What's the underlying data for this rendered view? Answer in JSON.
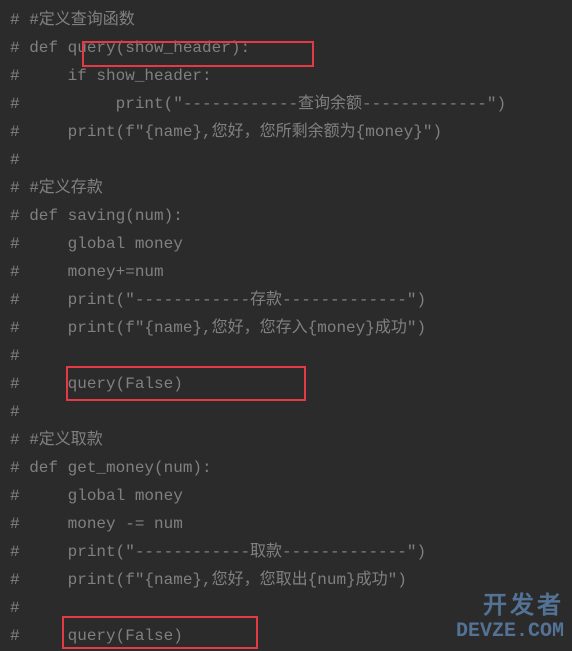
{
  "code": {
    "lines": [
      "# #定义查询函数",
      "# def query(show_header):",
      "#     if show_header:",
      "#          print(\"------------查询余额-------------\")",
      "#     print(f\"{name},您好，您所剩余额为{money}\")",
      "#",
      "# #定义存款",
      "# def saving(num):",
      "#     global money",
      "#     money+=num",
      "#     print(\"------------存款-------------\")",
      "#     print(f\"{name},您好，您存入{money}成功\")",
      "#",
      "#     query(False)",
      "#",
      "# #定义取款",
      "# def get_money(num):",
      "#     global money",
      "#     money -= num",
      "#     print(\"------------取款-------------\")",
      "#     print(f\"{name},您好，您取出{num}成功\")",
      "#",
      "#     query(False)"
    ]
  },
  "watermark": {
    "line1": "开发者",
    "line2": "DEVZE.COM"
  }
}
